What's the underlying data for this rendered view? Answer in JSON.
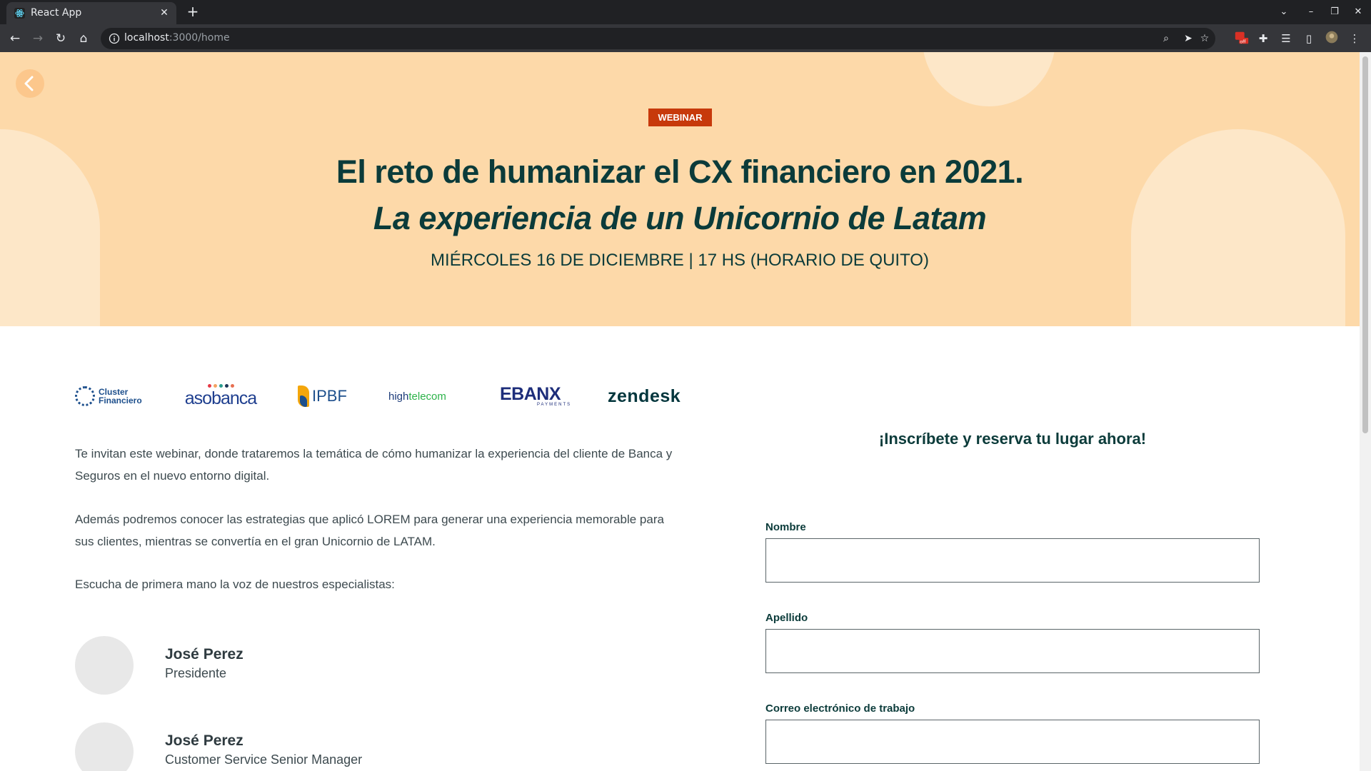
{
  "browser": {
    "tab_title": "React App",
    "url_host": "localhost",
    "url_path": ":3000/home",
    "colors": {
      "chrome_bg": "#202124",
      "toolbar_bg": "#35363a"
    }
  },
  "hero": {
    "badge": "WEBINAR",
    "title": "El reto de humanizar el CX financiero en 2021.",
    "subtitle": "La experiencia de un Unicornio de Latam",
    "date": "MIÉRCOLES 16 DE DICIEMBRE | 17 HS (HORARIO DE QUITO)",
    "colors": {
      "background": "#fdd9a9",
      "accent": "#c7390b",
      "heading": "#0b3b3a"
    }
  },
  "logos": {
    "cluster_line1": "Cluster",
    "cluster_line2": "Financiero",
    "asobanca": "asobanca",
    "ipbf": "IPBF",
    "high_a": "high",
    "high_b": "telecom",
    "ebanx": "EBANX",
    "ebanx_sub": "PAYMENTS",
    "zendesk": "zendesk"
  },
  "content": {
    "p1": "Te invitan este webinar, donde trataremos la temática de cómo humanizar la experiencia del cliente de Banca y Seguros en el nuevo entorno digital.",
    "p2": "Además podremos conocer las estrategias que aplicó LOREM para generar una experiencia memorable para sus clientes, mientras se convertía en el gran Unicornio de LATAM.",
    "p3": "Escucha de primera mano la voz de nuestros especialistas:"
  },
  "speakers": [
    {
      "name": "José Perez",
      "role": "Presidente"
    },
    {
      "name": "José Perez",
      "role": "Customer Service Senior Manager"
    }
  ],
  "form": {
    "title": "¡Inscríbete y reserva tu lugar ahora!",
    "fields": [
      {
        "label": "Nombre",
        "value": ""
      },
      {
        "label": "Apellido",
        "value": ""
      },
      {
        "label": "Correo electrónico de trabajo",
        "value": ""
      }
    ]
  },
  "icons": {
    "back": "chevron-left-icon",
    "zoom": "zoom-icon",
    "share": "send-icon",
    "bookmark": "star-icon",
    "extensions": "puzzle-icon",
    "reading_list": "list-icon",
    "side_panel": "side-panel-icon",
    "menu": "kebab-menu-icon"
  }
}
